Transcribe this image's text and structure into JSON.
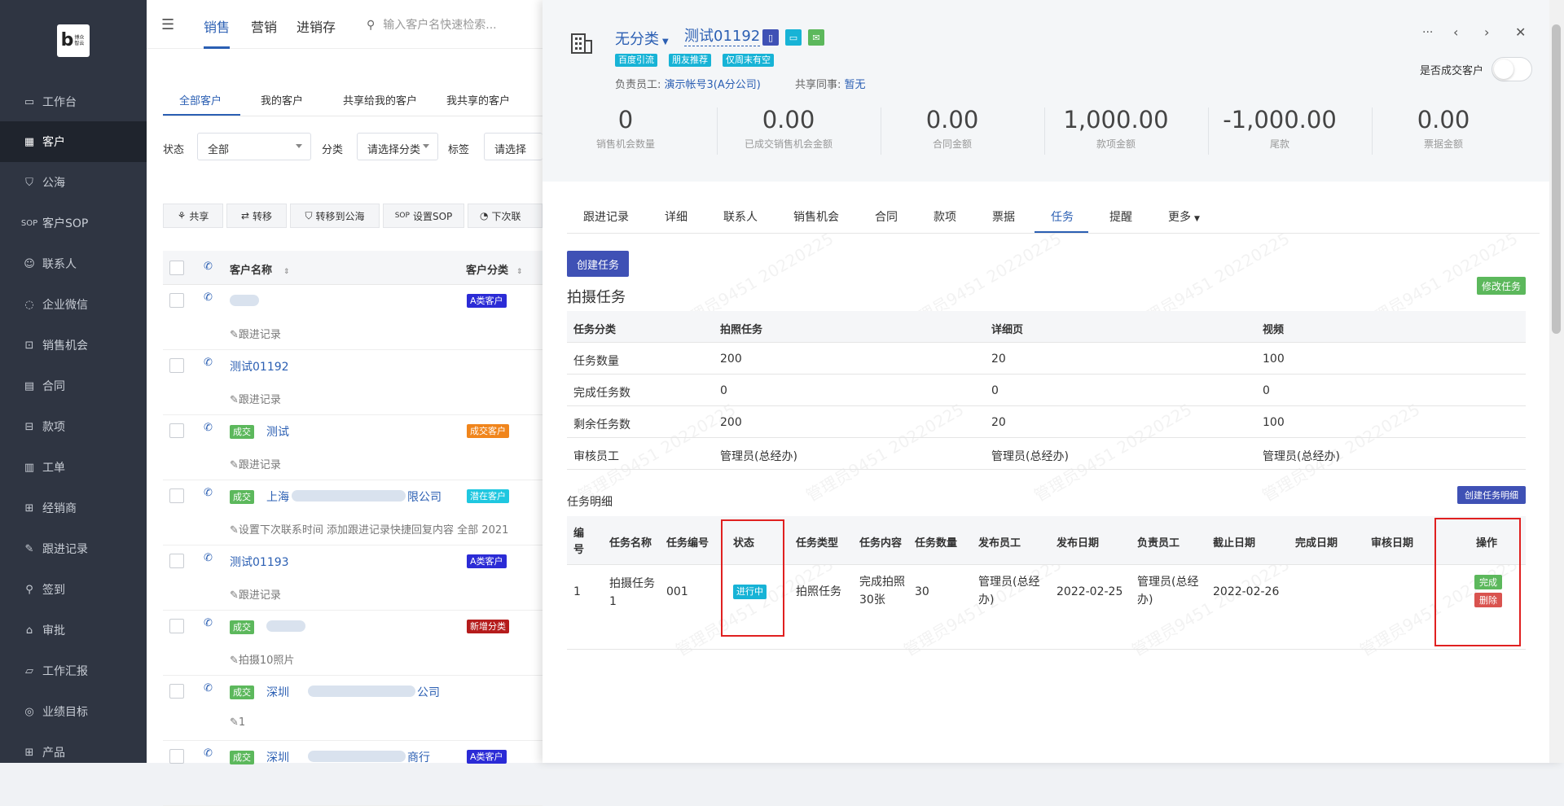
{
  "sidebar": {
    "logo_text": "博众智云",
    "items": [
      {
        "label": "工作台",
        "icon": "monitor-icon"
      },
      {
        "label": "客户",
        "icon": "building-icon"
      },
      {
        "label": "公海",
        "icon": "sea-icon"
      },
      {
        "label": "客户SOP",
        "icon": "sop-icon"
      },
      {
        "label": "联系人",
        "icon": "person-icon"
      },
      {
        "label": "企业微信",
        "icon": "wechat-icon"
      },
      {
        "label": "销售机会",
        "icon": "bag-icon"
      },
      {
        "label": "合同",
        "icon": "contract-icon"
      },
      {
        "label": "款项",
        "icon": "payment-icon"
      },
      {
        "label": "工单",
        "icon": "ticket-icon"
      },
      {
        "label": "经销商",
        "icon": "dealer-icon"
      },
      {
        "label": "跟进记录",
        "icon": "edit-icon"
      },
      {
        "label": "签到",
        "icon": "location-icon"
      },
      {
        "label": "审批",
        "icon": "approve-icon"
      },
      {
        "label": "工作汇报",
        "icon": "report-icon"
      },
      {
        "label": "业绩目标",
        "icon": "target-icon"
      },
      {
        "label": "产品",
        "icon": "grid-icon"
      }
    ]
  },
  "topbar": {
    "tabs": [
      "销售",
      "营销",
      "进销存"
    ],
    "search_placeholder": "输入客户名快速检索..."
  },
  "customers": {
    "subtabs": [
      "全部客户",
      "我的客户",
      "共享给我的客户",
      "我共享的客户"
    ],
    "filters": {
      "status_label": "状态",
      "status_value": "全部",
      "category_label": "分类",
      "category_value": "请选择分类",
      "tag_label": "标签",
      "tag_value": "请选择"
    },
    "actions": [
      "共享",
      "转移",
      "转移到公海",
      "设置SOP",
      "下次联"
    ],
    "headers": {
      "name": "客户名称",
      "category": "客户分类"
    },
    "rows": [
      {
        "name": "",
        "deal": "",
        "badge": "A类客户",
        "badge_color": "#2b2bd6",
        "note": "跟进记录"
      },
      {
        "name": "测试01192",
        "deal": "",
        "badge": "",
        "badge_color": "",
        "note": "跟进记录"
      },
      {
        "name": "测试",
        "deal": "成交",
        "badge": "成交客户",
        "badge_color": "#f0851c",
        "note": "跟进记录"
      },
      {
        "name": "上海",
        "name_suffix": "限公司",
        "deal": "成交",
        "badge": "潜在客户",
        "badge_color": "#1fc7e0",
        "note": "设置下次联系时间 添加跟进记录快捷回复内容 全部 2021"
      },
      {
        "name": "测试01193",
        "deal": "",
        "badge": "A类客户",
        "badge_color": "#2b2bd6",
        "note": "跟进记录"
      },
      {
        "name": "",
        "deal": "成交",
        "badge": "新增分类",
        "badge_color": "#b51c1c",
        "note": "拍摄10照片"
      },
      {
        "name": "深圳",
        "name_suffix": "公司",
        "deal": "成交",
        "badge": "",
        "badge_color": "",
        "note": "1"
      },
      {
        "name": "深圳",
        "name_suffix": "商行",
        "deal": "成交",
        "badge": "A类客户",
        "badge_color": "#2b2bd6",
        "note": ""
      }
    ]
  },
  "drawer": {
    "category": "无分类",
    "customer_name": "测试01192",
    "tags": [
      "百度引流",
      "朋友推荐",
      "仅周末有空"
    ],
    "owner_label": "负责员工:",
    "owner_value": "演示帐号3(A分公司)",
    "shared_label": "共享同事:",
    "shared_value": "暂无",
    "is_deal_label": "是否成交客户",
    "stats": [
      {
        "value": "0",
        "label": "销售机会数量"
      },
      {
        "value": "0.00",
        "label": "已成交销售机会金额"
      },
      {
        "value": "0.00",
        "label": "合同金额"
      },
      {
        "value": "1,000.00",
        "label": "款项金额"
      },
      {
        "value": "-1,000.00",
        "label": "尾款"
      },
      {
        "value": "0.00",
        "label": "票据金额"
      }
    ],
    "tabs": [
      "跟进记录",
      "详细",
      "联系人",
      "销售机会",
      "合同",
      "款项",
      "票据",
      "任务",
      "提醒",
      "更多"
    ],
    "create_task": "创建任务",
    "section_title": "拍摄任务",
    "edit_task": "修改任务",
    "task_table": {
      "headers": [
        "任务分类",
        "拍照任务",
        "详细页",
        "视频"
      ],
      "rows": [
        [
          "任务数量",
          "200",
          "20",
          "100"
        ],
        [
          "完成任务数",
          "0",
          "0",
          "0"
        ],
        [
          "剩余任务数",
          "200",
          "20",
          "100"
        ],
        [
          "审核员工",
          "管理员(总经办)",
          "管理员(总经办)",
          "管理员(总经办)"
        ]
      ]
    },
    "detail_title": "任务明细",
    "create_detail": "创建任务明细",
    "detail_headers": [
      "编号",
      "任务名称",
      "任务编号",
      "状态",
      "任务类型",
      "任务内容",
      "任务数量",
      "发布员工",
      "发布日期",
      "负责员工",
      "截止日期",
      "完成日期",
      "审核日期",
      "操作"
    ],
    "detail_row": {
      "id": "1",
      "name": "拍摄任务1",
      "code": "001",
      "status": "进行中",
      "type": "拍照任务",
      "content": "完成拍照30张",
      "qty": "30",
      "publisher": "管理员(总经办)",
      "publish_date": "2022-02-25",
      "owner": "管理员(总经办)",
      "deadline": "2022-02-26",
      "finish_date": "",
      "audit_date": "",
      "op_done": "完成",
      "op_delete": "删除"
    },
    "watermark": "管理员9451 20220225"
  }
}
